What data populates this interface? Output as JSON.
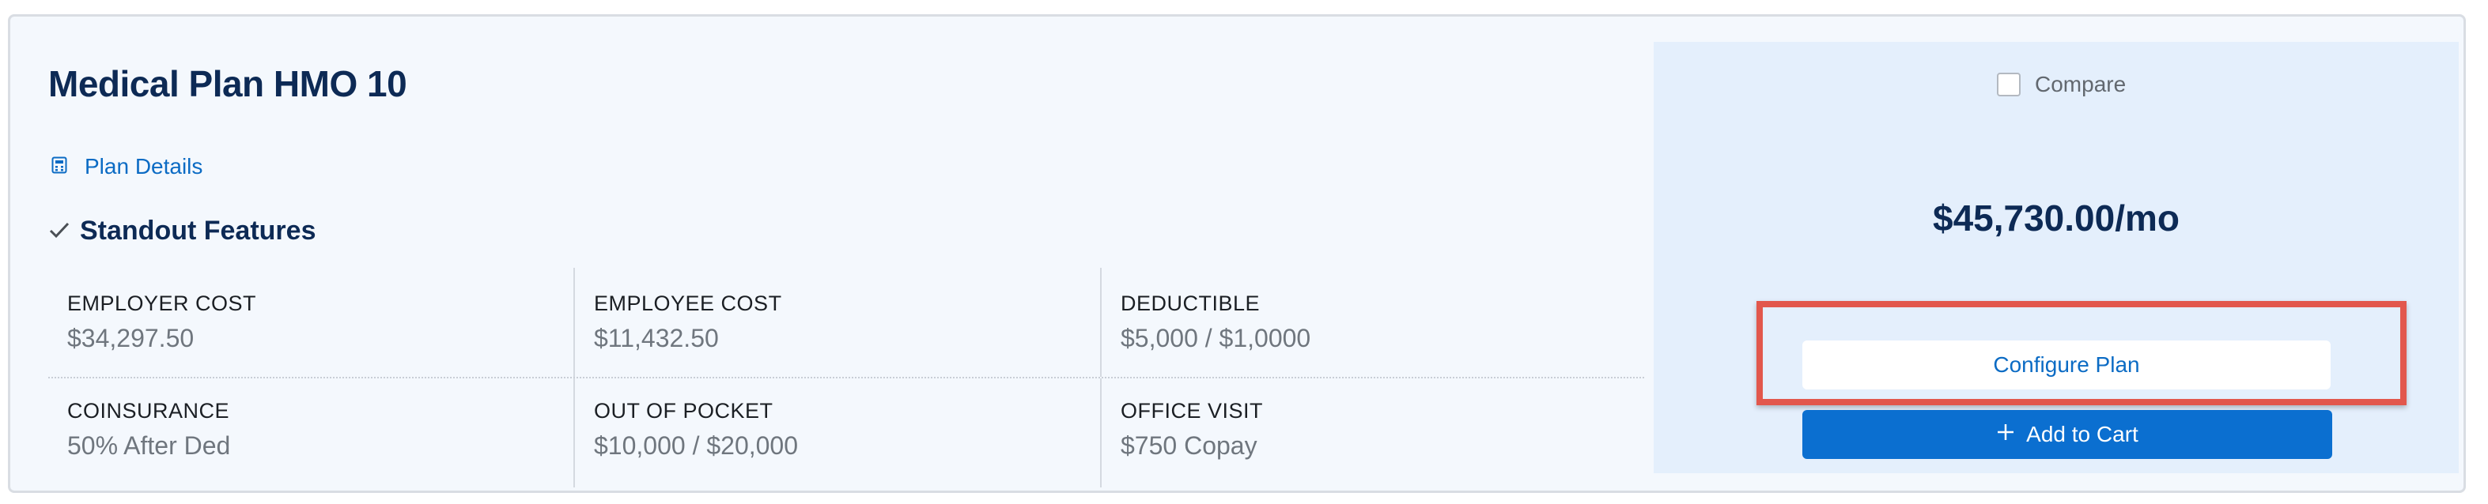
{
  "plan": {
    "title": "Medical Plan HMO 10",
    "details_link": "Plan Details",
    "features_heading": "Standout Features"
  },
  "features": [
    {
      "label": "EMPLOYER COST",
      "value": "$34,297.50"
    },
    {
      "label": "EMPLOYEE COST",
      "value": "$11,432.50"
    },
    {
      "label": "DEDUCTIBLE",
      "value": "$5,000 / $1,0000"
    },
    {
      "label": "COINSURANCE",
      "value": "50% After Ded"
    },
    {
      "label": "OUT OF POCKET",
      "value": "$10,000 / $20,000"
    },
    {
      "label": "OFFICE VISIT",
      "value": "$750 Copay"
    }
  ],
  "sidebar": {
    "compare_label": "Compare",
    "compare_checked": false,
    "price": "$45,730.00/mo",
    "configure_label": "Configure Plan",
    "add_to_cart_label": "Add to Cart"
  },
  "icons": {
    "details": "calculator-icon",
    "features": "checkmark-icon",
    "add": "plus-icon"
  },
  "colors": {
    "title": "#0d2a55",
    "link": "#0b6bc4",
    "primary_button": "#0b6fd0",
    "highlight_border": "#e2574c",
    "side_panel": "#e4effc"
  }
}
